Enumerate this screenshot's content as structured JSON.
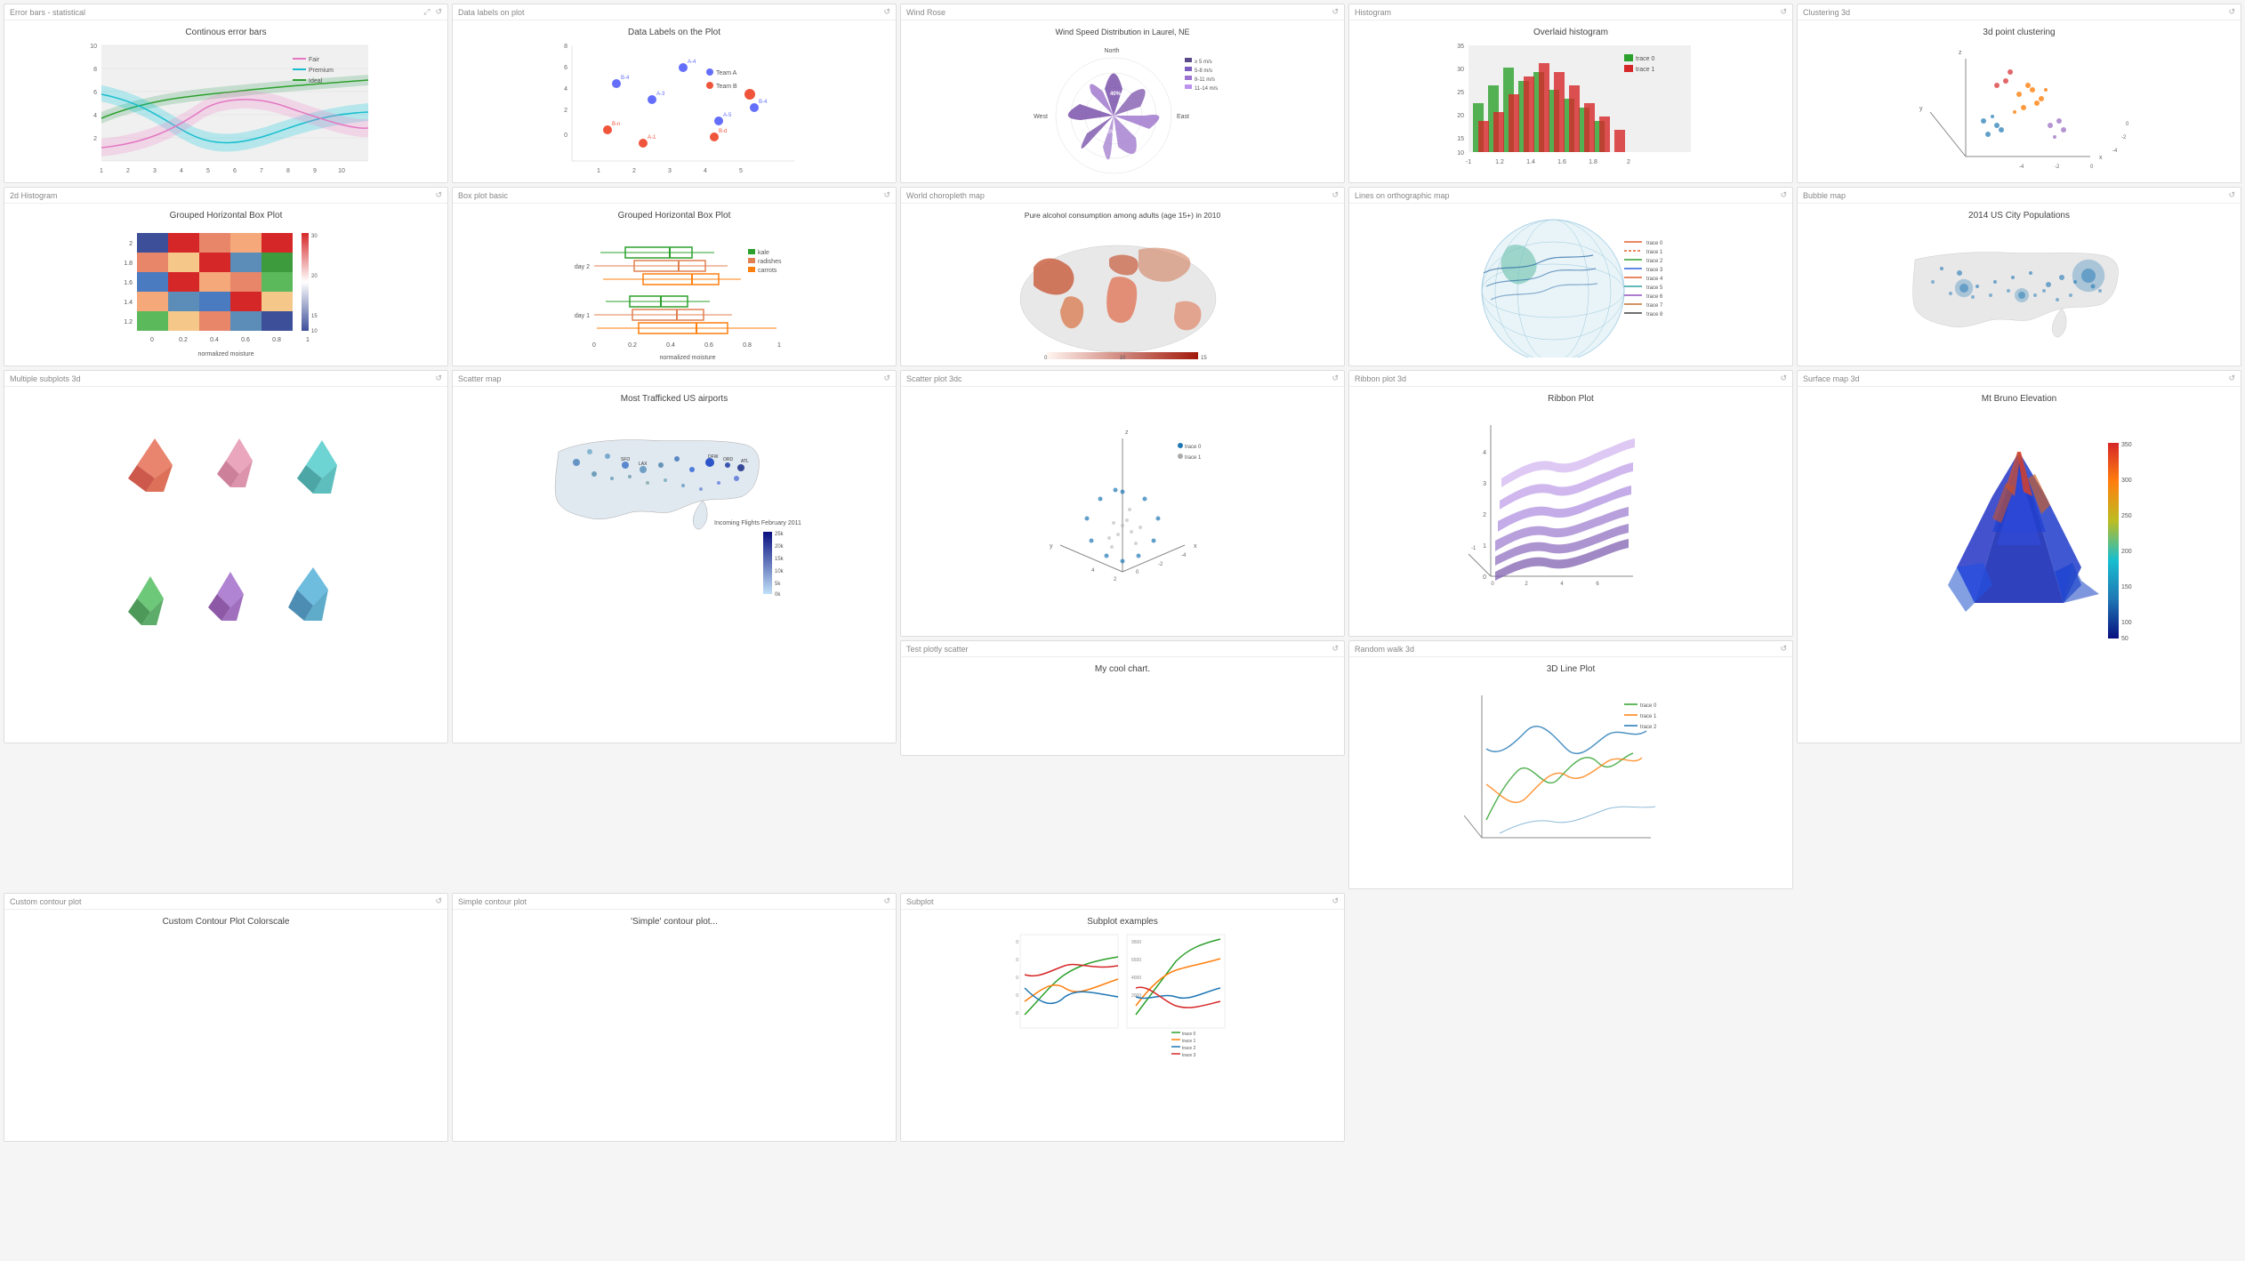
{
  "cards": [
    {
      "id": "error-bars",
      "header_label": "Error bars - statistical",
      "title": "Continous error bars",
      "type": "line_error",
      "row": 1
    },
    {
      "id": "data-labels",
      "header_label": "Data labels on plot",
      "title": "Data Labels on the Plot",
      "type": "scatter_labels",
      "row": 1
    },
    {
      "id": "wind-rose",
      "header_label": "Wind Rose",
      "title": "Wind Speed Distribution in Laurel, NE",
      "type": "wind_rose",
      "row": 1
    },
    {
      "id": "histogram",
      "header_label": "Histogram",
      "title": "Overlaid histogram",
      "type": "histogram",
      "row": 1
    },
    {
      "id": "clustering-3d",
      "header_label": "Clustering 3d",
      "title": "3d point clustering",
      "type": "scatter3d",
      "row": 1
    },
    {
      "id": "2d-histogram",
      "header_label": "2d Histogram",
      "title": "Grouped Horizontal Box Plot",
      "type": "heatmap",
      "row": 2
    },
    {
      "id": "box-plot",
      "header_label": "Box plot basic",
      "title": "Grouped Horizontal Box Plot",
      "type": "box_plot",
      "row": 2
    },
    {
      "id": "choropleth",
      "header_label": "World choropleth map",
      "title": "Pure alcohol consumption among adults (age 15+) in 2010",
      "type": "choropleth",
      "row": 2
    },
    {
      "id": "ortho-map",
      "header_label": "Lines on orthographic map",
      "title": "",
      "type": "ortho_map",
      "row": 2
    },
    {
      "id": "bubble-map",
      "header_label": "Bubble map",
      "title": "2014 US City Populations",
      "type": "bubble_map",
      "row": 2
    },
    {
      "id": "multiple-subplots",
      "header_label": "Multiple subplots 3d",
      "title": "",
      "type": "multi3d",
      "row": 3
    },
    {
      "id": "scatter-map",
      "header_label": "Scatter map",
      "title": "Most Trafficked US airports",
      "type": "scatter_map",
      "row": 3
    },
    {
      "id": "scatter-3d",
      "header_label": "Scatter plot 3dc",
      "title": "",
      "type": "scatter3d_2",
      "row": 3
    },
    {
      "id": "ribbon-3d",
      "header_label": "Ribbon plot 3d",
      "title": "Ribbon Plot",
      "type": "ribbon3d",
      "row": 3
    },
    {
      "id": "surface-3d",
      "header_label": "Surface map 3d",
      "title": "Mt Bruno Elevation",
      "type": "surface3d",
      "row": 3
    },
    {
      "id": "random-walk",
      "header_label": "Random walk 3d",
      "title": "3D Line Plot",
      "type": "line3d",
      "row": 3,
      "sub": true
    },
    {
      "id": "custom-contour",
      "header_label": "Custom contour plot",
      "title": "Custom Contour Plot Colorscale",
      "type": "contour_custom",
      "row": 3,
      "sub": true
    },
    {
      "id": "simple-contour",
      "header_label": "Simple contour plot",
      "title": "'Simple' contour plot...",
      "type": "contour_simple",
      "row": 3,
      "sub": true
    },
    {
      "id": "subplot",
      "header_label": "Subplot",
      "title": "Subplot examples",
      "type": "subplot",
      "row": 3,
      "sub": true
    },
    {
      "id": "test-scatter",
      "header_label": "Test plotly scatter",
      "title": "My cool chart.",
      "type": "test_scatter",
      "row": 4
    }
  ],
  "colors": {
    "accent_blue": "#5B8DB8",
    "accent_teal": "#17BECF",
    "accent_pink": "#EF553B",
    "accent_green": "#00CC96",
    "accent_purple": "#AB63FA",
    "accent_orange": "#FFA15A",
    "light_gray": "#E5ECF6",
    "card_bg": "#ffffff",
    "header_bg": "#f9f9f9"
  },
  "icons": {
    "refresh": "↺",
    "expand": "⤢",
    "menu": "⋮"
  }
}
